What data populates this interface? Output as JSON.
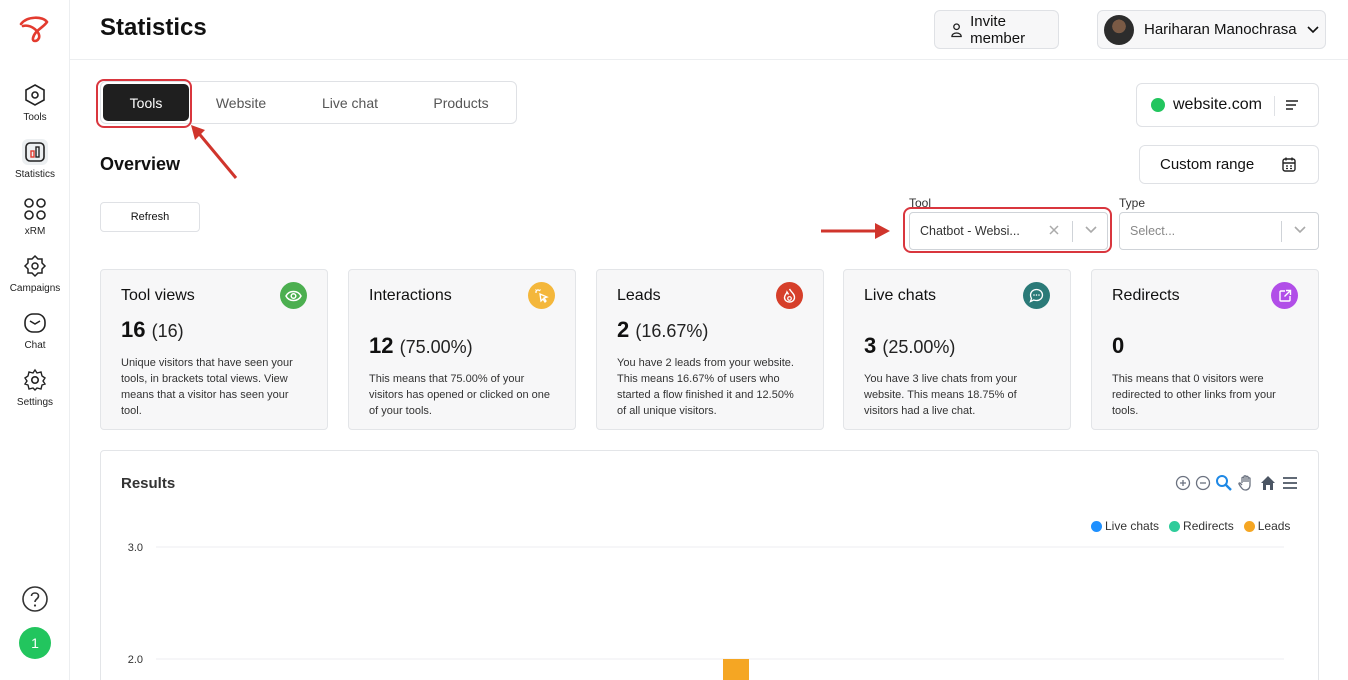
{
  "sidebar": {
    "items": [
      {
        "label": "Tools",
        "icon": "hexagon-icon"
      },
      {
        "label": "Statistics",
        "icon": "bar-chart-icon"
      },
      {
        "label": "xRM",
        "icon": "grid-icon"
      },
      {
        "label": "Campaigns",
        "icon": "badge-icon"
      },
      {
        "label": "Chat",
        "icon": "chat-icon"
      },
      {
        "label": "Settings",
        "icon": "gear-icon"
      }
    ],
    "notification_count": "1"
  },
  "header": {
    "title": "Statistics",
    "invite_label": "Invite member",
    "user_name": "Hariharan Manochrasa"
  },
  "tabs": [
    "Tools",
    "Website",
    "Live chat",
    "Products"
  ],
  "active_tab": "Tools",
  "site": {
    "name": "website.com"
  },
  "overview": {
    "title": "Overview",
    "range_label": "Custom range",
    "refresh_label": "Refresh"
  },
  "filters": {
    "tool_label": "Tool",
    "tool_value": "Chatbot - Websi...",
    "type_label": "Type",
    "type_placeholder": "Select..."
  },
  "cards": [
    {
      "title": "Tool views",
      "value": "16",
      "sub": "(16)",
      "desc": "Unique visitors that have seen your tools, in brackets total views. View means that a visitor has seen your tool.",
      "color": "#4caf50"
    },
    {
      "title": "Interactions",
      "value": "12",
      "sub": "(75.00%)",
      "desc": "This means that 75.00% of your visitors has opened or clicked on one of your tools.",
      "color": "#f4b73b"
    },
    {
      "title": "Leads",
      "value": "2",
      "sub": "(16.67%)",
      "desc": "You have 2 leads from your website. This means 16.67% of users who started a flow finished it and 12.50% of all unique visitors.",
      "color": "#d63f2a"
    },
    {
      "title": "Live chats",
      "value": "3",
      "sub": "(25.00%)",
      "desc": "You have 3 live chats from your website. This means 18.75% of visitors had a live chat.",
      "color": "#2b7a78"
    },
    {
      "title": "Redirects",
      "value": "0",
      "sub": "",
      "desc": "This means that 0 visitors were redirected to other links from your tools.",
      "color": "#b14ee8"
    }
  ],
  "chart_data": {
    "type": "bar",
    "title": "Results",
    "series": [
      {
        "name": "Live chats",
        "color": "#1e90ff"
      },
      {
        "name": "Redirects",
        "color": "#2ecc9a"
      },
      {
        "name": "Leads",
        "color": "#f5a623",
        "values": [
          2.0
        ]
      }
    ],
    "y_ticks": [
      "3.0",
      "2.0"
    ],
    "ylim_visible": [
      2.0,
      3.0
    ],
    "legend_position": "top-right"
  }
}
